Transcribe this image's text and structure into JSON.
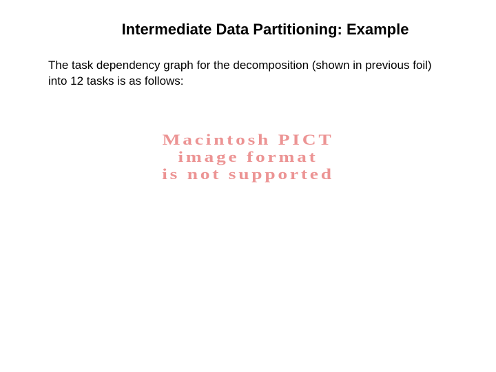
{
  "title": "Intermediate Data Partitioning: Example",
  "body": "The task dependency graph for the decomposition (shown in previous foil) into 12 tasks is as follows:",
  "pict_error": {
    "line1": "Macintosh PICT",
    "line2": "image format",
    "line3": "is not supported"
  }
}
